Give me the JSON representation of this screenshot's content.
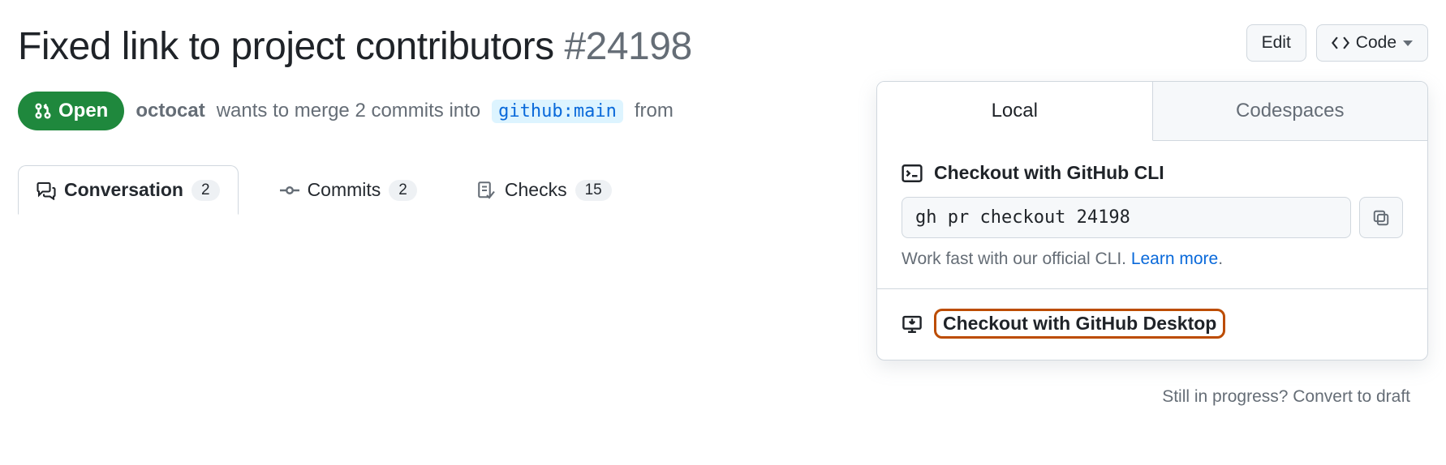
{
  "header": {
    "title": "Fixed link to project contributors",
    "number": "#24198",
    "edit_label": "Edit",
    "code_label": "Code"
  },
  "meta": {
    "state": "Open",
    "author": "octocat",
    "merge_text_1": "wants to merge 2 commits into",
    "base_branch": "github:main",
    "merge_text_2": "from"
  },
  "tabs": {
    "conversation": {
      "label": "Conversation",
      "count": "2"
    },
    "commits": {
      "label": "Commits",
      "count": "2"
    },
    "checks": {
      "label": "Checks",
      "count": "15"
    }
  },
  "panel": {
    "tab_local": "Local",
    "tab_codespaces": "Codespaces",
    "cli_title": "Checkout with GitHub CLI",
    "cli_cmd": "gh pr checkout 24198",
    "cli_hint": "Work fast with our official CLI. ",
    "cli_learn": "Learn more",
    "desktop_title": "Checkout with GitHub Desktop"
  },
  "footer": {
    "progress": "Still in progress?",
    "convert": "Convert to draft"
  }
}
